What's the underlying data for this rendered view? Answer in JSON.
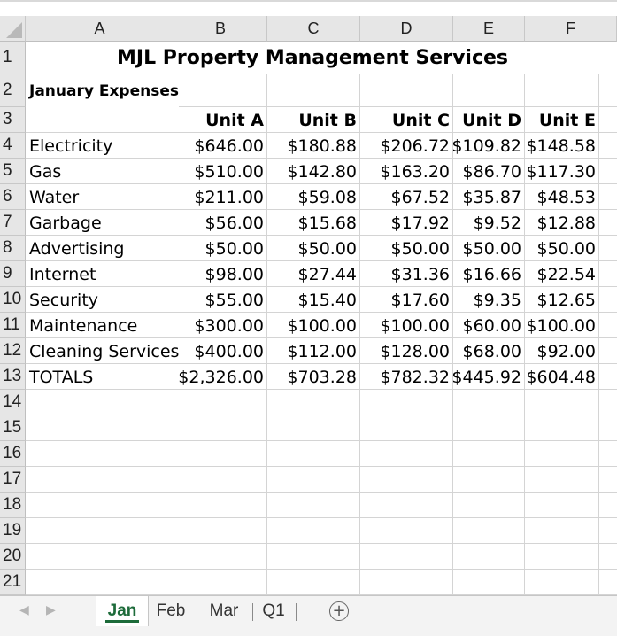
{
  "columns": [
    "A",
    "B",
    "C",
    "D",
    "E",
    "F"
  ],
  "rows": [
    "1",
    "2",
    "3",
    "4",
    "5",
    "6",
    "7",
    "8",
    "9",
    "10",
    "11",
    "12",
    "13",
    "14",
    "15",
    "16",
    "17",
    "18",
    "19",
    "20",
    "21"
  ],
  "title": "MJL Property Management Services",
  "subtitle": "January Expenses",
  "header": [
    "Unit A",
    "Unit B",
    "Unit C",
    "Unit D",
    "Unit E"
  ],
  "table": [
    {
      "label": "Electricity",
      "values": [
        "$646.00",
        "$180.88",
        "$206.72",
        "$109.82",
        "$148.58"
      ]
    },
    {
      "label": "Gas",
      "values": [
        "$510.00",
        "$142.80",
        "$163.20",
        "$86.70",
        "$117.30"
      ]
    },
    {
      "label": "Water",
      "values": [
        "$211.00",
        "$59.08",
        "$67.52",
        "$35.87",
        "$48.53"
      ]
    },
    {
      "label": "Garbage",
      "values": [
        "$56.00",
        "$15.68",
        "$17.92",
        "$9.52",
        "$12.88"
      ]
    },
    {
      "label": "Advertising",
      "values": [
        "$50.00",
        "$50.00",
        "$50.00",
        "$50.00",
        "$50.00"
      ]
    },
    {
      "label": "Internet",
      "values": [
        "$98.00",
        "$27.44",
        "$31.36",
        "$16.66",
        "$22.54"
      ]
    },
    {
      "label": "Security",
      "values": [
        "$55.00",
        "$15.40",
        "$17.60",
        "$9.35",
        "$12.65"
      ]
    },
    {
      "label": "Maintenance",
      "values": [
        "$300.00",
        "$100.00",
        "$100.00",
        "$60.00",
        "$100.00"
      ]
    },
    {
      "label": "Cleaning Services",
      "values": [
        "$400.00",
        "$112.00",
        "$128.00",
        "$68.00",
        "$92.00"
      ]
    },
    {
      "label": "TOTALS",
      "values": [
        "$2,326.00",
        "$703.28",
        "$782.32",
        "$445.92",
        "$604.48"
      ]
    }
  ],
  "tabs": {
    "active": "Jan",
    "items": [
      "Jan",
      "Feb",
      "Mar",
      "Q1"
    ],
    "add": "+"
  },
  "nav": {
    "prev": "◀",
    "next": "▶"
  },
  "colors": {
    "accent": "#1d6b3a",
    "header_bg": "#e6e6e6",
    "grid": "#d4d4d4"
  }
}
